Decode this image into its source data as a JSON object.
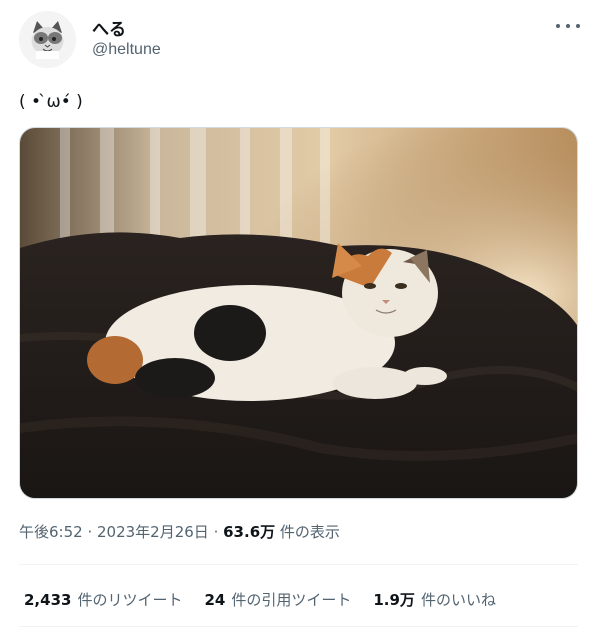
{
  "author": {
    "display_name": "へる",
    "handle": "@heltune"
  },
  "tweet": {
    "text": "( • ̀ω•́ )",
    "image_alt": "calico cat lying on dark bedding"
  },
  "meta": {
    "time": "午後6:52",
    "separator1": " · ",
    "date": "2023年2月26日",
    "separator2": " · ",
    "views_count": "63.6万",
    "views_label": " 件の表示"
  },
  "stats": {
    "retweets_count": "2,433",
    "retweets_label": "件のリツイート",
    "quotes_count": "24",
    "quotes_label": "件の引用ツイート",
    "likes_count": "1.9万",
    "likes_label": "件のいいね"
  },
  "icons": {
    "more": "more-horizontal-icon"
  },
  "colors": {
    "text_primary": "#0f1419",
    "text_secondary": "#536471",
    "divider": "#eff3f4"
  }
}
